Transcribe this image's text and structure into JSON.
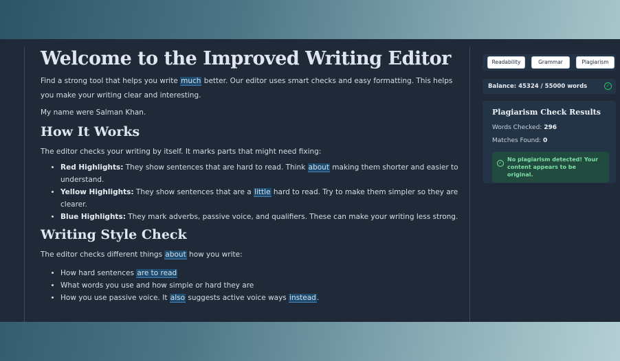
{
  "editor": {
    "title": "Welcome to the Improved Writing Editor",
    "intro_pre": "Find a strong tool that helps you write ",
    "intro_hl": "much",
    "intro_post": " better. Our editor uses smart checks and easy formatting. This helps you make your writing clear and interesting.",
    "name_line": "My name were Salman Khan.",
    "how_heading": "How It Works",
    "how_text": "The editor checks your writing by itself. It marks parts that might need fixing:",
    "bullets": {
      "red_label": "Red Highlights:",
      "red_pre": " They show sentences that are hard to read. Think ",
      "red_hl": "about",
      "red_post": " making them shorter and easier to understand.",
      "yellow_label": "Yellow Highlights:",
      "yellow_pre": " They show sentences that are a ",
      "yellow_hl": "little",
      "yellow_post": " hard to read. Try to make them simpler so they are clearer.",
      "blue_label": "Blue Highlights:",
      "blue_text": " They mark adverbs, passive voice, and qualifiers. These can make your writing less strong."
    },
    "style_heading": "Writing Style Check",
    "style_pre": "The editor checks different things ",
    "style_hl": "about",
    "style_post": " how you write:",
    "style_items": {
      "item1_pre": "How hard sentences ",
      "item1_hl": "are to read",
      "item2": "What words you use and how simple or hard they are",
      "item3_pre": "How you use passive voice. It ",
      "item3_hl1": "also",
      "item3_mid": " suggests active voice ways ",
      "item3_hl2": "instead",
      "item3_post": "."
    }
  },
  "panel": {
    "buttons": {
      "readability": "Readability",
      "grammar": "Grammar",
      "plagiarism": "Plagiarism"
    },
    "balance": "Balance: 45324 / 55000 words",
    "results": {
      "title": "Plagiarism Check Results",
      "words_label": "Words Checked:",
      "words_value": "296",
      "matches_label": "Matches Found:",
      "matches_value": "0",
      "success": "No plagiarism detected! Your content appears to be original."
    }
  },
  "colors": {
    "accent_success": "#22c55e",
    "highlight_blue": "#1f4b6e",
    "background": "#1f2937"
  }
}
